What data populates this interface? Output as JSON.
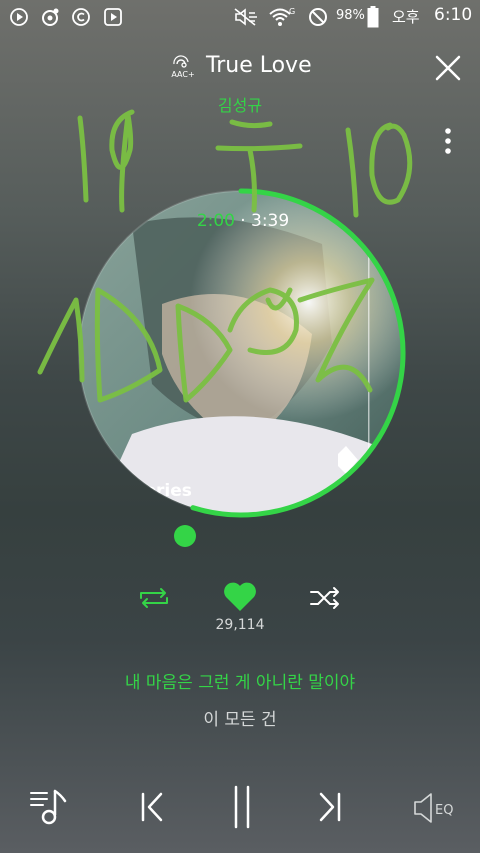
{
  "status_bar": {
    "battery": "98%",
    "ampm": "오후",
    "time": "6:10",
    "network": "G",
    "icons": [
      "play-notif-icon",
      "music-notif-icon",
      "copyright-notif-icon",
      "video-notif-icon",
      "mute-icon",
      "wifi-icon",
      "blocked-icon",
      "battery-icon"
    ]
  },
  "header": {
    "codec_label": "AAC+",
    "title": "True Love",
    "artist": "김성규"
  },
  "player": {
    "current_time": "2:00",
    "separator": "·",
    "total_time": "3:39",
    "progress_fraction": 0.548,
    "cover_text": "Stories",
    "like_count": "29,114"
  },
  "lyrics": {
    "current": "내 마음은 그런 게 아니란 말이야",
    "next": "이 모든 건"
  },
  "colors": {
    "accent": "#34d447",
    "text": "#ffffff",
    "muted": "#d5d8d8",
    "scribble": "#7bc043"
  },
  "bottom_bar": {
    "eq_label": "EQ"
  }
}
